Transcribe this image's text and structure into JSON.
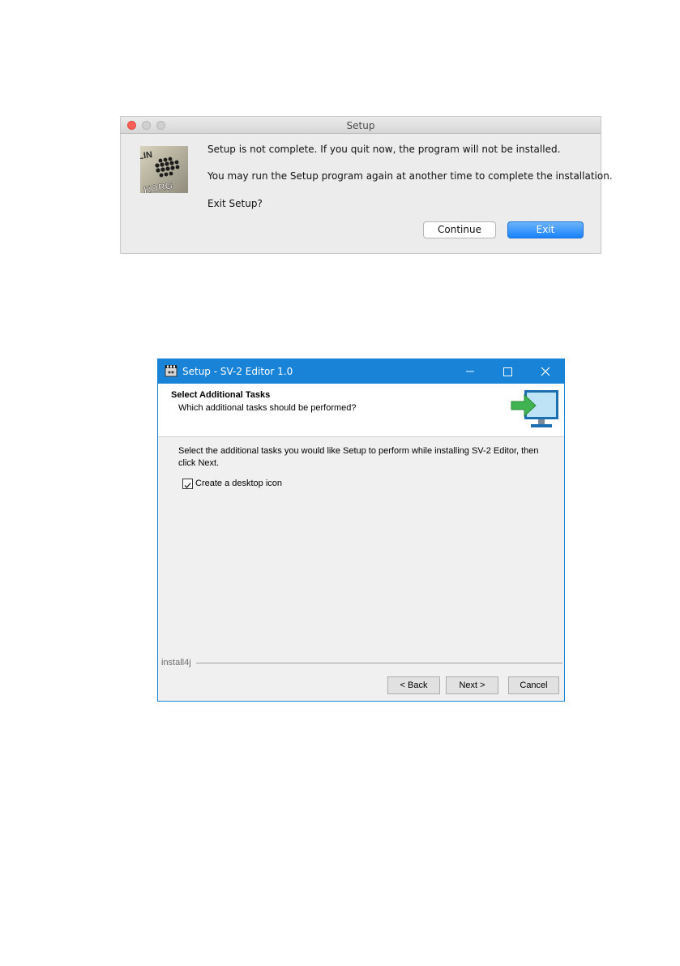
{
  "mac_dialog": {
    "title": "Setup",
    "logo_text": "KORG",
    "message": "Setup is not complete. If you quit now, the program will not be installed.",
    "detail": "You may run the Setup program again at another time to complete the installation.",
    "question": "Exit Setup?",
    "continue_label": "Continue",
    "exit_label": "Exit",
    "accent_color": "#1a82fb"
  },
  "win_wizard": {
    "title": "Setup - SV-2 Editor 1.0",
    "header_title": "Select Additional Tasks",
    "header_subtitle": "Which additional tasks should be performed?",
    "description": "Select the additional tasks you would like Setup to perform while installing SV-2 Editor, then click Next.",
    "task_label": "Create a desktop icon",
    "task_checked": true,
    "brand": "install4j",
    "back_label": "< Back",
    "next_label": "Next >",
    "cancel_label": "Cancel",
    "titlebar_color": "#1883d7"
  }
}
